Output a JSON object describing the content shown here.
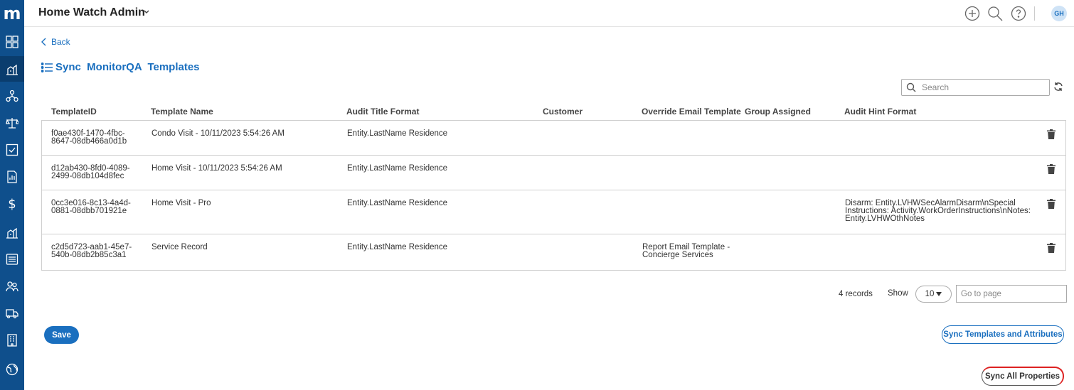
{
  "app": {
    "logo": "m",
    "title": "Home Watch Admin",
    "user_initials": "GH"
  },
  "sidebar": {
    "items": [
      {
        "icon": "dashboard-icon"
      },
      {
        "icon": "properties-icon",
        "active": true
      },
      {
        "icon": "workflow-icon"
      },
      {
        "icon": "scale-icon"
      },
      {
        "icon": "checklist-icon"
      },
      {
        "icon": "report-icon"
      },
      {
        "icon": "dollar-icon",
        "glyph": "$"
      },
      {
        "icon": "properties-alt-icon"
      },
      {
        "icon": "list-icon"
      },
      {
        "icon": "users-icon"
      },
      {
        "icon": "truck-icon"
      },
      {
        "icon": "building-icon"
      },
      {
        "icon": "globe-icon"
      }
    ]
  },
  "topbar": {
    "icons": [
      "add-icon",
      "search-icon",
      "help-icon"
    ]
  },
  "nav": {
    "back_label": "Back"
  },
  "page": {
    "title": "Sync  MonitorQA  Templates"
  },
  "search": {
    "placeholder": "Search"
  },
  "table": {
    "columns": [
      "TemplateID",
      "Template Name",
      "Audit Title Format",
      "Customer",
      "Override Email Template",
      "Group Assigned",
      "Audit Hint Format"
    ],
    "rows": [
      {
        "id_line1": "f0ae430f-1470-4fbc-",
        "id_line2": "8647-08db466a0d1b",
        "name": "Condo Visit - 10/11/2023 5:54:26 AM",
        "title_format": "Entity.LastName Residence",
        "customer": "",
        "email_line1": "",
        "email_line2": "",
        "group": "",
        "hint_line1": "",
        "hint_line2": "",
        "hint_line3": ""
      },
      {
        "id_line1": "d12ab430-8fd0-4089-",
        "id_line2": "2499-08db104d8fec",
        "name": "Home Visit - 10/11/2023 5:54:26 AM",
        "title_format": "Entity.LastName Residence",
        "customer": "",
        "email_line1": "",
        "email_line2": "",
        "group": "",
        "hint_line1": "",
        "hint_line2": "",
        "hint_line3": ""
      },
      {
        "id_line1": "0cc3e016-8c13-4a4d-",
        "id_line2": "0881-08dbb701921e",
        "name": "Home Visit - Pro",
        "title_format": "Entity.LastName Residence",
        "customer": "",
        "email_line1": "",
        "email_line2": "",
        "group": "",
        "hint_line1": "Disarm: Entity.LVHWSecAlarmDisarm\\nSpecial",
        "hint_line2": "Instructions: Activity.WorkOrderInstructions\\nNotes:",
        "hint_line3": "Entity.LVHWOthNotes"
      },
      {
        "id_line1": "c2d5d723-aab1-45e7-",
        "id_line2": "540b-08db2b85c3a1",
        "name": "Service Record",
        "title_format": "Entity.LastName Residence",
        "customer": "",
        "email_line1": "Report Email Template -",
        "email_line2": "Concierge Services",
        "group": "",
        "hint_line1": "",
        "hint_line2": "",
        "hint_line3": ""
      }
    ]
  },
  "pagination": {
    "records": "4 records",
    "show_label": "Show",
    "page_size": "10",
    "goto_placeholder": "Go to page"
  },
  "buttons": {
    "save": "Save",
    "sync_templates": "Sync Templates and Attributes",
    "sync_properties": "Sync All Properties"
  }
}
